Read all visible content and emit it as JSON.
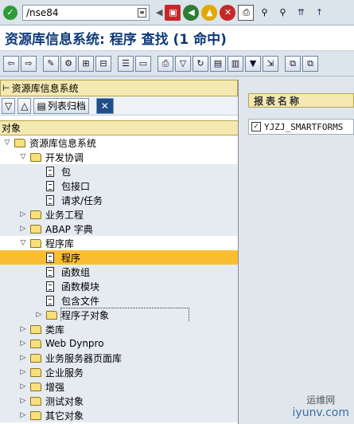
{
  "colors": {
    "accent": "#0c3a7a",
    "selected": "#fbbe32",
    "header_bg": "#f5e9b2"
  },
  "command": {
    "value": "/nse84"
  },
  "title": "资源库信息系统: 程序 查找 (1 命中)",
  "left": {
    "header": "资源库信息系统",
    "buttons": {
      "list_archive": "列表归档"
    },
    "object_header": "对象",
    "tree": [
      {
        "label": "资源库信息系统",
        "kind": "folder",
        "exp": "open"
      },
      {
        "label": "开发协调",
        "kind": "folder",
        "exp": "open"
      },
      {
        "label": "包",
        "kind": "doc"
      },
      {
        "label": "包接口",
        "kind": "doc"
      },
      {
        "label": "请求/任务",
        "kind": "doc"
      },
      {
        "label": "业务工程",
        "kind": "folder",
        "exp": "closed"
      },
      {
        "label": "ABAP 字典",
        "kind": "folder",
        "exp": "closed"
      },
      {
        "label": "程序库",
        "kind": "folder",
        "exp": "open"
      },
      {
        "label": "程序",
        "kind": "doc",
        "sel": true
      },
      {
        "label": "函数组",
        "kind": "doc"
      },
      {
        "label": "函数模块",
        "kind": "doc"
      },
      {
        "label": "包含文件",
        "kind": "doc"
      },
      {
        "label": "程序子对象",
        "kind": "folder",
        "exp": "closed",
        "focus": true
      },
      {
        "label": "类库",
        "kind": "folder",
        "exp": "closed"
      },
      {
        "label": "Web Dynpro",
        "kind": "folder",
        "exp": "closed"
      },
      {
        "label": "业务服务器页面库",
        "kind": "folder",
        "exp": "closed"
      },
      {
        "label": "企业服务",
        "kind": "folder",
        "exp": "closed"
      },
      {
        "label": "增强",
        "kind": "folder",
        "exp": "closed"
      },
      {
        "label": "测试对象",
        "kind": "folder",
        "exp": "closed"
      },
      {
        "label": "其它对象",
        "kind": "folder",
        "exp": "closed"
      }
    ]
  },
  "right": {
    "column_header": "报表名称",
    "result": "YJZJ_SMARTFORMS"
  },
  "watermark": {
    "line1": "运维网",
    "line2": "iyunv.com"
  }
}
